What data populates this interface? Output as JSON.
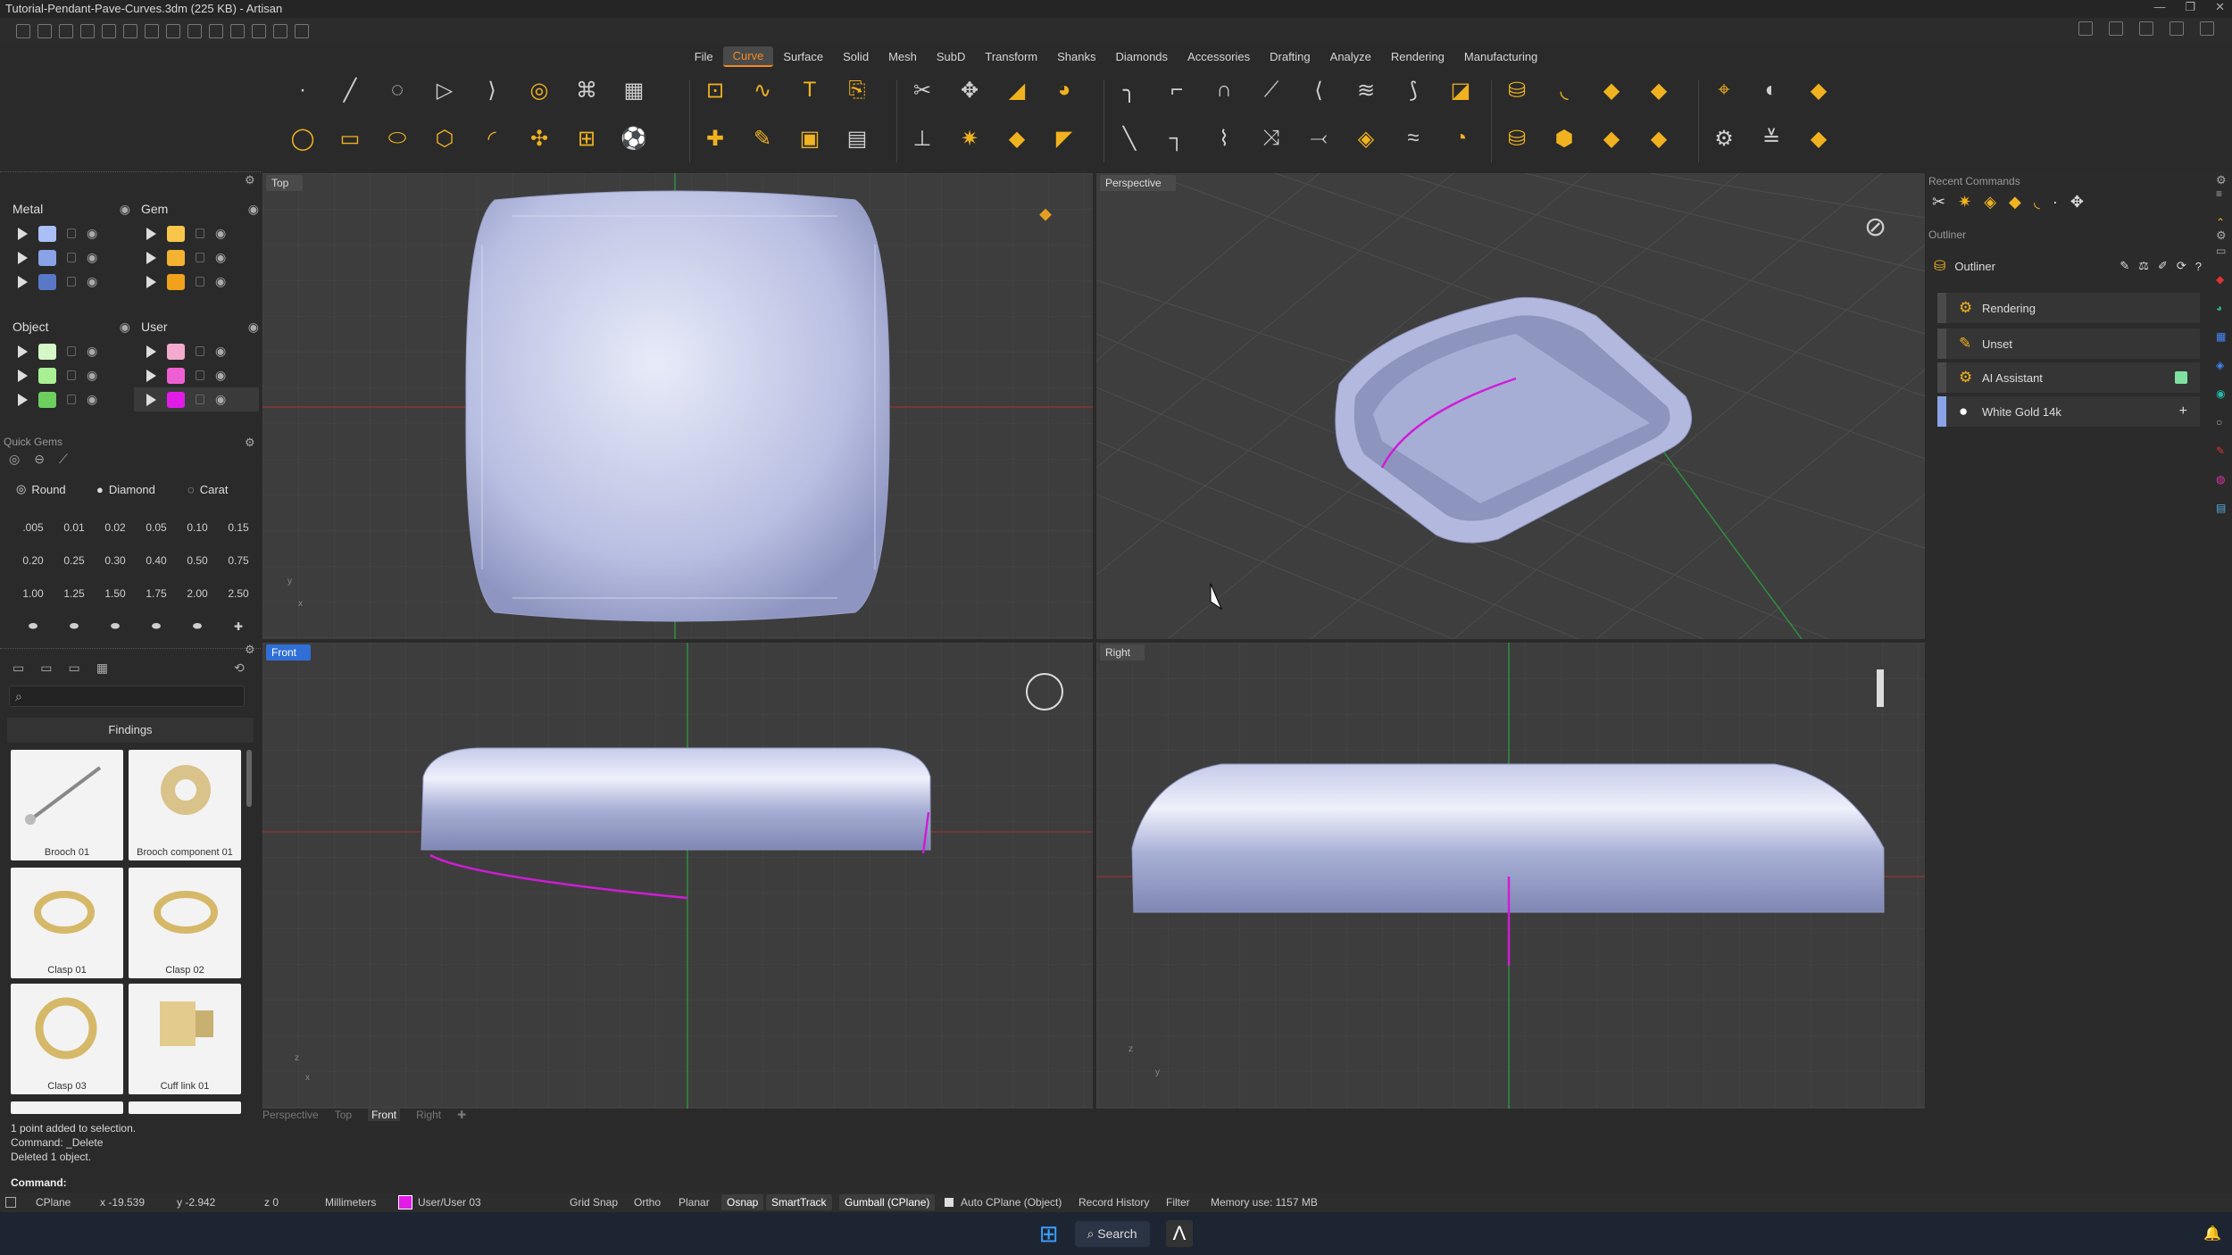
{
  "window": {
    "title": "Tutorial-Pendant-Pave-Curves.3dm (225 KB) - Artisan",
    "controls": [
      "—",
      "❐",
      "✕"
    ]
  },
  "menu": {
    "items": [
      "File",
      "Curve",
      "Surface",
      "Solid",
      "Mesh",
      "SubD",
      "Transform",
      "Shanks",
      "Diamonds",
      "Accessories",
      "Drafting",
      "Analyze",
      "Rendering",
      "Manufacturing"
    ],
    "active": "Curve"
  },
  "layers": {
    "groups": [
      {
        "title": "Metal",
        "colors": [
          "#a9bff5",
          "#8aa3e6",
          "#5a78c8"
        ]
      },
      {
        "title": "Gem",
        "colors": [
          "#f7c64a",
          "#f3b231",
          "#efa21a"
        ]
      },
      {
        "title": "Object",
        "colors": [
          "#d6f7c7",
          "#a9ef94",
          "#6ccf5e"
        ]
      },
      {
        "title": "User",
        "colors": [
          "#f4a9cf",
          "#ef5fd4",
          "#e11ce7"
        ]
      }
    ]
  },
  "quick_gems": {
    "header": "Quick Gems",
    "shape": "Round",
    "cut": "Diamond",
    "unit": "Carat",
    "sizes": [
      ".005",
      "0.01",
      "0.02",
      "0.05",
      "0.10",
      "0.15",
      "0.20",
      "0.25",
      "0.30",
      "0.40",
      "0.50",
      "0.75",
      "1.00",
      "1.25",
      "1.50",
      "1.75",
      "2.00",
      "2.50"
    ]
  },
  "library": {
    "search_placeholder": "",
    "category": "Findings",
    "items": [
      "Brooch 01",
      "Brooch component 01",
      "Clasp 01",
      "Clasp 02",
      "Clasp 03",
      "Cuff link 01"
    ]
  },
  "viewports": {
    "top": "Top",
    "perspective": "Perspective",
    "front": "Front",
    "right": "Right"
  },
  "viewport_tabs": [
    "Perspective",
    "Top",
    "Front",
    "Right"
  ],
  "viewport_tabs_active": "Front",
  "right_panel": {
    "recent_title": "Recent Commands",
    "outliner_title": "Outliner",
    "outliner_tab": "Outliner",
    "rows": [
      "Rendering",
      "Unset",
      "AI Assistant",
      "White Gold 14k"
    ]
  },
  "command": {
    "history": [
      "1 point added to selection.",
      "Command: _Delete",
      "Deleted 1 object."
    ],
    "prompt": "Command:"
  },
  "status": {
    "cplane": "CPlane",
    "x": "x -19.539",
    "y": "y -2.942",
    "z": "z 0",
    "units": "Millimeters",
    "layer": "User/User 03",
    "layer_color": "#e11ce7",
    "grid_snap": "Grid Snap",
    "ortho": "Ortho",
    "planar": "Planar",
    "osnap": "Osnap",
    "smarttrack": "SmartTrack",
    "gumball": "Gumball (CPlane)",
    "auto_cplane": "Auto CPlane (Object)",
    "record_history": "Record History",
    "filter": "Filter",
    "memory": "Memory use: 1157 MB"
  },
  "taskbar": {
    "search": "Search"
  }
}
